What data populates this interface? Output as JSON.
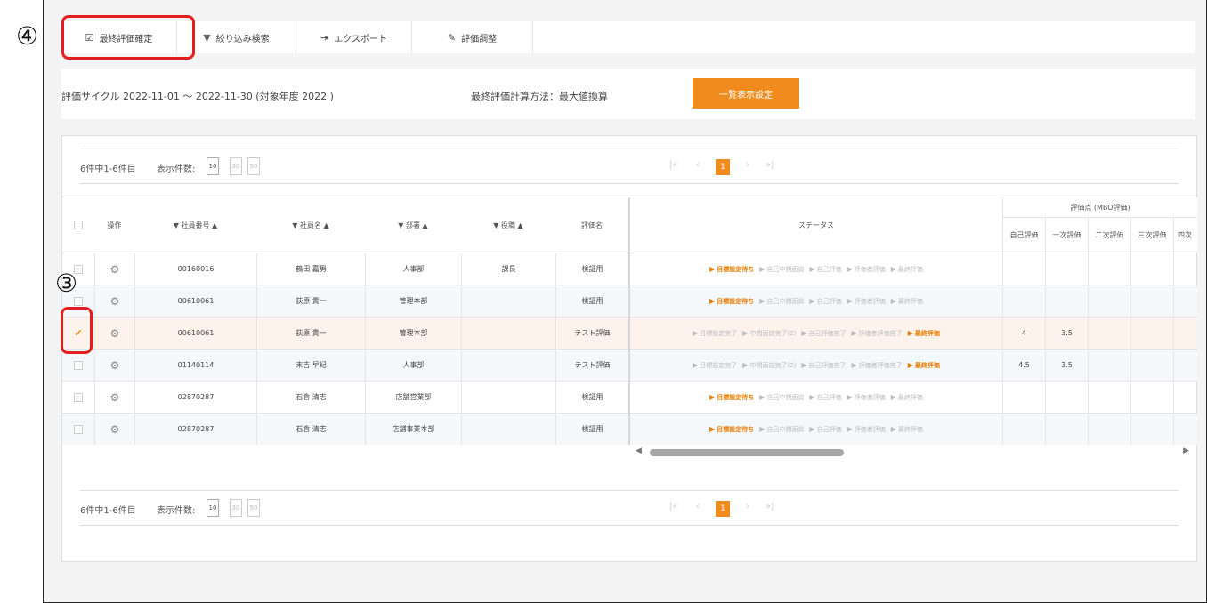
{
  "toolbar": {
    "final_eval_confirm": "最終評価確定",
    "filter_search": "絞り込み検索",
    "export": "エクスポート",
    "eval_adjust": "評価調整"
  },
  "info": {
    "cycle_text": "評価サイクル  2022-11-01  ～  2022-11-30   (対象年度  2022  )",
    "calc_method": "最終評価計算方法：最大値換算",
    "display_settings_button": "一覧表示設定"
  },
  "pagination": {
    "count_text": "6件中1-6件目",
    "page_size_label": "表示件数:",
    "page_sizes": [
      "10",
      "30",
      "50"
    ],
    "current_page": "1",
    "first": "|«",
    "prev": "‹",
    "next": "›",
    "last": "»|"
  },
  "table": {
    "headers": {
      "action": "操作",
      "emp_no": "▼ 社員番号 ▲",
      "emp_name": "▼ 社員名 ▲",
      "dept": "▼ 部署 ▲",
      "position": "▼ 役職 ▲",
      "eval_name": "評価名",
      "status": "ステータス",
      "score_group": "評価点 (MBO評価)",
      "self_eval": "自己評価",
      "first_eval": "一次評価",
      "second_eval": "二次評価",
      "third_eval": "三次評価",
      "fourth_eval": "四次"
    },
    "rows": [
      {
        "emp_no": "00160016",
        "name": "鶴田 嘉男",
        "dept": "人事部",
        "position": "課長",
        "eval_name": "検証用",
        "status": [
          "目標設定待ち",
          "自己中間面談",
          "自己評価",
          "評価者評価",
          "最終評価"
        ],
        "active": 0,
        "self": "",
        "first": "",
        "selected": false
      },
      {
        "emp_no": "00610061",
        "name": "荻原 貴一",
        "dept": "管理本部",
        "position": "",
        "eval_name": "検証用",
        "status": [
          "目標設定待ち",
          "自己中間面談",
          "自己評価",
          "評価者評価",
          "最終評価"
        ],
        "active": 0,
        "self": "",
        "first": "",
        "selected": false
      },
      {
        "emp_no": "00610061",
        "name": "荻原 貴一",
        "dept": "管理本部",
        "position": "",
        "eval_name": "テスト評価",
        "status": [
          "目標設定完了",
          "中間面談完了(2)",
          "自己評価完了",
          "評価者評価完了",
          "最終評価"
        ],
        "active": 4,
        "self": "4",
        "first": "3.5",
        "selected": true
      },
      {
        "emp_no": "01140114",
        "name": "末吉 早紀",
        "dept": "人事部",
        "position": "",
        "eval_name": "テスト評価",
        "status": [
          "目標設定完了",
          "中間面談完了(2)",
          "自己評価完了",
          "評価者評価完了",
          "最終評価"
        ],
        "active": 4,
        "self": "4.5",
        "first": "3.5",
        "selected": false
      },
      {
        "emp_no": "02870287",
        "name": "石倉 清志",
        "dept": "店舗営業部",
        "position": "",
        "eval_name": "検証用",
        "status": [
          "目標設定待ち",
          "自己中間面談",
          "自己評価",
          "評価者評価",
          "最終評価"
        ],
        "active": 0,
        "self": "",
        "first": "",
        "selected": false
      },
      {
        "emp_no": "02870287",
        "name": "石倉 清志",
        "dept": "店舗事業本部",
        "position": "",
        "eval_name": "検証用",
        "status": [
          "目標設定待ち",
          "自己中間面談",
          "自己評価",
          "評価者評価",
          "最終評価"
        ],
        "active": 0,
        "self": "",
        "first": "",
        "selected": false
      }
    ]
  },
  "annotations": {
    "step3": "③",
    "step4": "④"
  },
  "colors": {
    "accent": "#f08c1e",
    "highlight": "#e21f1f"
  },
  "icons": {
    "confirm": "checkbox-edit-icon",
    "filter": "filter-icon",
    "export": "export-icon",
    "adjust": "pencil-icon",
    "row_action": "gear-icon"
  }
}
